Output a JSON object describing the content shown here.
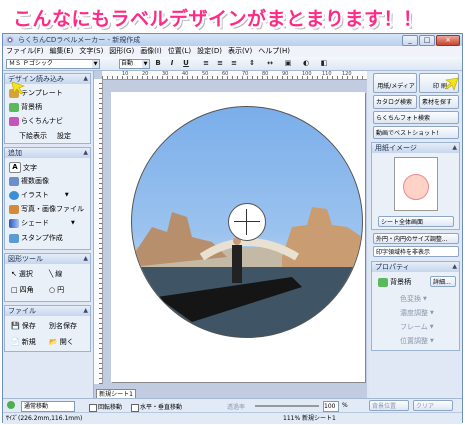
{
  "banner": {
    "text": "こんなにもラベルデザインがまとまります！！"
  },
  "window": {
    "title": "らくちんCDラベルメーカー - 新規作成",
    "buttons": [
      "_",
      "□",
      "×"
    ]
  },
  "menu": [
    "ファイル(F)",
    "編集(E)",
    "文字(S)",
    "図形(G)",
    "画像(I)",
    "位置(L)",
    "設定(D)",
    "表示(V)",
    "ヘルプ(H)"
  ],
  "toolbar": {
    "font": "ＭＳ Ｐゴシック",
    "size": "自動",
    "bold": "B",
    "italic": "I",
    "underline": "U"
  },
  "left": {
    "design": {
      "header": "デザイン読み込み",
      "template": "テンプレート",
      "background": "背景柄",
      "navi": "らくちんナビ",
      "title_display": "下絵表示",
      "settings": "設定"
    },
    "add": {
      "header": "追加",
      "items": [
        "文字",
        "複数画像",
        "イラスト",
        "写真・画像ファイル",
        "シェード",
        "スタンプ作成"
      ]
    },
    "shape": {
      "header": "図形ツール",
      "items": [
        "選択",
        "線",
        "四角",
        "円"
      ]
    },
    "file": {
      "header": "ファイル",
      "items": [
        "保存",
        "別名保存",
        "新規",
        "開く"
      ]
    }
  },
  "canvas": {
    "sheet_tab": "新規シート1",
    "ruler_marks": [
      "10",
      "20",
      "30",
      "40",
      "50",
      "60",
      "70",
      "80",
      "90",
      "100",
      "110",
      "120"
    ]
  },
  "right": {
    "paper_media": "用紙/メディア",
    "print": "印 刷",
    "catalog_search": "カタログ検索",
    "find_material": "素材を探す",
    "photo_search": "らくちんフォト検索",
    "video_shot": "動画でベストショット!",
    "paper_image_header": "用紙イメージ",
    "sheet_all_screen": "シート全体画面",
    "outer_inner_adjust": "外円・内円のサイズ調整...",
    "print_frame_select": "印字領域枠を非表示",
    "property_header": "プロパティ",
    "bg_label": "背景柄",
    "detail": "詳細...",
    "prop_items": [
      "色変換",
      "濃度調整",
      "フレーム",
      "位置調整"
    ]
  },
  "status": {
    "move_mode": "通常移動",
    "rotate_move": "回転移動",
    "hv_move": "水平・垂直移動",
    "zoom_label": "透過率",
    "zoom_value": "100",
    "zoom_unit": "%",
    "bg_position": "背景位置",
    "clear": "クリア",
    "coords": "ｻｲｽﾞ(226.2mm,116.1mm)",
    "sheet": "111% 新規シート1"
  },
  "colors": {
    "banner_pink": "#ff2a86",
    "window_blue": "#dbe6f4",
    "highlight_arrow": "#f3e417"
  }
}
